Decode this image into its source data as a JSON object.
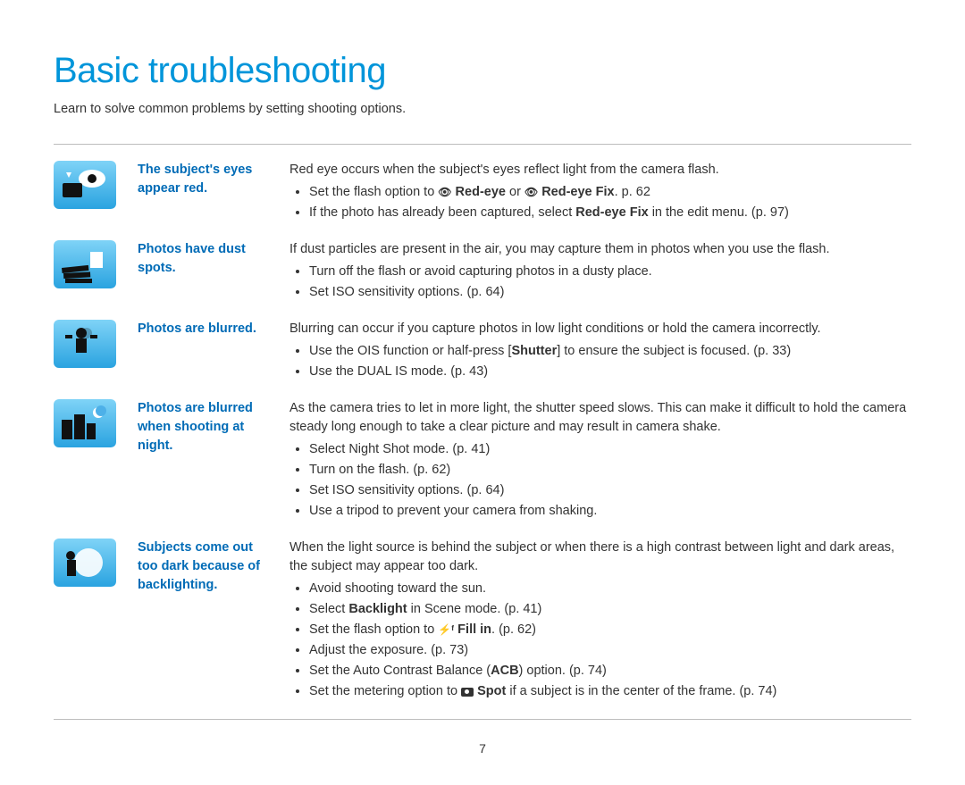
{
  "title": "Basic troubleshooting",
  "subtitle": "Learn to solve common problems by setting shooting options.",
  "pageNumber": "7",
  "rows": [
    {
      "problem": "The subject's eyes appear red.",
      "lead": "Red eye occurs when the subject's eyes reflect light from the camera flash.",
      "bullets": [
        {
          "pre": "Set the flash option to ",
          "icon": "👁",
          "bold": " Red-eye",
          "mid": " or ",
          "icon2": "👁",
          "bold2": " Red-eye Fix",
          "post": ". p. 62"
        },
        {
          "pre": "If the photo has already been captured, select ",
          "bold": "Red-eye Fix",
          "post": " in the edit menu. (p. 97)"
        }
      ]
    },
    {
      "problem": "Photos have dust spots.",
      "lead": "If dust particles are present in the air, you may capture them in photos when you use the flash.",
      "bullets": [
        {
          "text": "Turn off the flash or avoid capturing photos in a dusty place."
        },
        {
          "text": "Set ISO sensitivity options. (p. 64)"
        }
      ]
    },
    {
      "problem": "Photos are blurred.",
      "lead": "Blurring can occur if you capture photos in low light conditions or hold the camera incorrectly.",
      "bullets": [
        {
          "pre": "Use the OIS function or half-press [",
          "bold": "Shutter",
          "post": "] to ensure the subject is focused. (p. 33)"
        },
        {
          "text": "Use the DUAL IS mode. (p. 43)"
        }
      ]
    },
    {
      "problem": "Photos are blurred when shooting at night.",
      "lead": "As the camera tries to let in more light, the shutter speed slows. This can make it difficult to hold the camera steady long enough to take a clear picture and may result in camera shake.",
      "bullets": [
        {
          "text": "Select Night Shot mode. (p. 41)"
        },
        {
          "text": "Turn on the flash. (p. 62)"
        },
        {
          "text": "Set ISO sensitivity options. (p. 64)"
        },
        {
          "text": "Use a tripod to prevent your camera from shaking."
        }
      ]
    },
    {
      "problem": "Subjects come out too dark because of backlighting.",
      "lead": "When the light source is behind the subject or when there is a high contrast between light and dark areas, the subject may appear too dark.",
      "bullets": [
        {
          "text": "Avoid shooting toward the sun."
        },
        {
          "pre": "Select ",
          "bold": "Backlight",
          "post": " in Scene mode. (p. 41)"
        },
        {
          "pre": "Set the flash option to ",
          "icon": "⚡ᶠ",
          "bold": " Fill in",
          "post": ". (p. 62)"
        },
        {
          "text": "Adjust the exposure. (p. 73)"
        },
        {
          "pre": "Set the Auto Contrast Balance (",
          "bold": "ACB",
          "post": ") option. (p. 74)"
        },
        {
          "pre": "Set the metering option to ",
          "iconBox": true,
          "bold": " Spot",
          "post": " if a subject is in the center of the frame. (p. 74)"
        }
      ]
    }
  ]
}
